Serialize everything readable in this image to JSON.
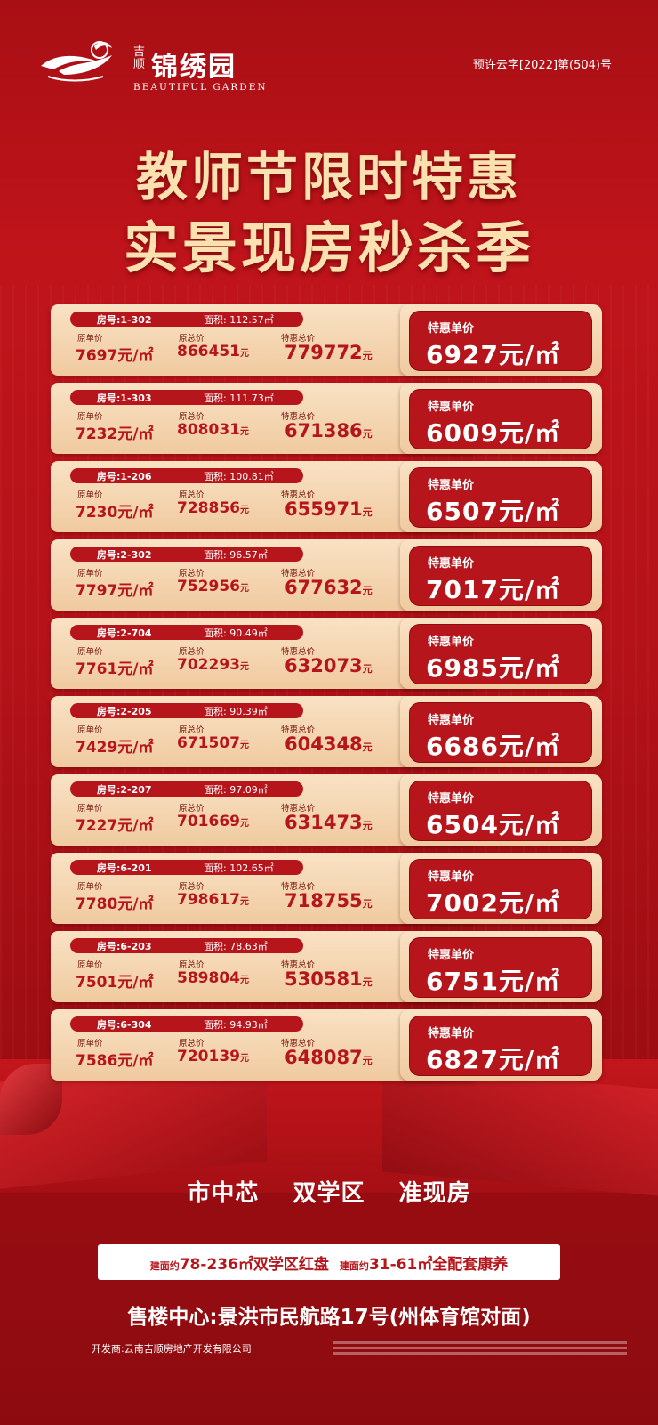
{
  "brand": {
    "prefix": "吉顺",
    "name": "锦绣园",
    "english": "BEAUTIFUL GARDEN"
  },
  "permit": "预许云字[2022]第(504)号",
  "headline": {
    "line1": "教师节限时特惠",
    "line2": "实景现房秒杀季"
  },
  "labels": {
    "room": "房号:",
    "area": "面积:",
    "orig_unit_price": "原单价",
    "orig_total": "原总价",
    "special_total": "特惠总价",
    "special_unit_price": "特惠单价"
  },
  "units": [
    {
      "room": "1-302",
      "area": "112.57㎡",
      "orig_unit": "7697元/㎡",
      "orig_total": "866451",
      "special_total": "779772",
      "special_unit": "6927元/㎡"
    },
    {
      "room": "1-303",
      "area": "111.73㎡",
      "orig_unit": "7232元/㎡",
      "orig_total": "808031",
      "special_total": "671386",
      "special_unit": "6009元/㎡"
    },
    {
      "room": "1-206",
      "area": "100.81㎡",
      "orig_unit": "7230元/㎡",
      "orig_total": "728856",
      "special_total": "655971",
      "special_unit": "6507元/㎡"
    },
    {
      "room": "2-302",
      "area": "96.57㎡",
      "orig_unit": "7797元/㎡",
      "orig_total": "752956",
      "special_total": "677632",
      "special_unit": "7017元/㎡"
    },
    {
      "room": "2-704",
      "area": "90.49㎡",
      "orig_unit": "7761元/㎡",
      "orig_total": "702293",
      "special_total": "632073",
      "special_unit": "6985元/㎡"
    },
    {
      "room": "2-205",
      "area": "90.39㎡",
      "orig_unit": "7429元/㎡",
      "orig_total": "671507",
      "special_total": "604348",
      "special_unit": "6686元/㎡"
    },
    {
      "room": "2-207",
      "area": "97.09㎡",
      "orig_unit": "7227元/㎡",
      "orig_total": "701669",
      "special_total": "631473",
      "special_unit": "6504元/㎡"
    },
    {
      "room": "6-201",
      "area": "102.65㎡",
      "orig_unit": "7780元/㎡",
      "orig_total": "798617",
      "special_total": "718755",
      "special_unit": "7002元/㎡"
    },
    {
      "room": "6-203",
      "area": "78.63㎡",
      "orig_unit": "7501元/㎡",
      "orig_total": "589804",
      "special_total": "530581",
      "special_unit": "6751元/㎡"
    },
    {
      "room": "6-304",
      "area": "94.93㎡",
      "orig_unit": "7586元/㎡",
      "orig_total": "720139",
      "special_total": "648087",
      "special_unit": "6827元/㎡"
    }
  ],
  "currency_suffix": "元",
  "features": [
    "市中芯",
    "双学区",
    "准现房"
  ],
  "banner": {
    "left_prefix": "建面约",
    "left_main": "78-236㎡双学区红盘",
    "right_prefix": "建面约",
    "right_main": "31-61㎡全配套康养"
  },
  "sales_center": "售楼中心:景洪市民航路17号(州体育馆对面)",
  "developer": "开发商:云南吉顺房地产开发有限公司",
  "colors": {
    "brand_red": "#b5151b",
    "card_cream": "#f9e2c4",
    "headline_gold": "#fbe0b0"
  }
}
